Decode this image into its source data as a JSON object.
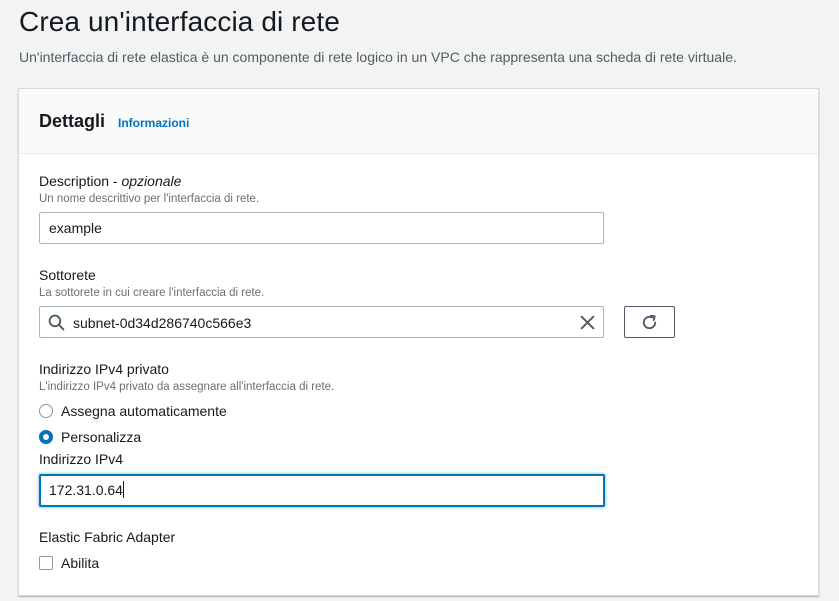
{
  "header": {
    "title": "Crea un'interfaccia di rete",
    "description": "Un'interfaccia di rete elastica è un componente di rete logico in un VPC che rappresenta una scheda di rete virtuale."
  },
  "details": {
    "title": "Dettagli",
    "info_link": "Informazioni"
  },
  "description_field": {
    "label": "Description",
    "label_separator": " - ",
    "optional": "opzionale",
    "hint": "Un nome descrittivo per l'interfaccia di rete.",
    "value": "example"
  },
  "subnet_field": {
    "label": "Sottorete",
    "hint": "La sottorete in cui creare l'interfaccia di rete.",
    "value": "subnet-0d34d286740c566e3"
  },
  "ipv4_field": {
    "label": "Indirizzo IPv4 privato",
    "hint": "L'indirizzo IPv4 privato da assegnare all'interfaccia di rete.",
    "options": [
      {
        "label": "Assegna automaticamente",
        "selected": false
      },
      {
        "label": "Personalizza",
        "selected": true
      }
    ],
    "address_label": "Indirizzo IPv4",
    "address_value": "172.31.0.64"
  },
  "efa_field": {
    "label": "Elastic Fabric Adapter",
    "checkbox_label": "Abilita",
    "checked": false
  },
  "colors": {
    "link": "#0073bb",
    "focus": "#0073bb",
    "text": "#16191f",
    "muted": "#687078"
  }
}
